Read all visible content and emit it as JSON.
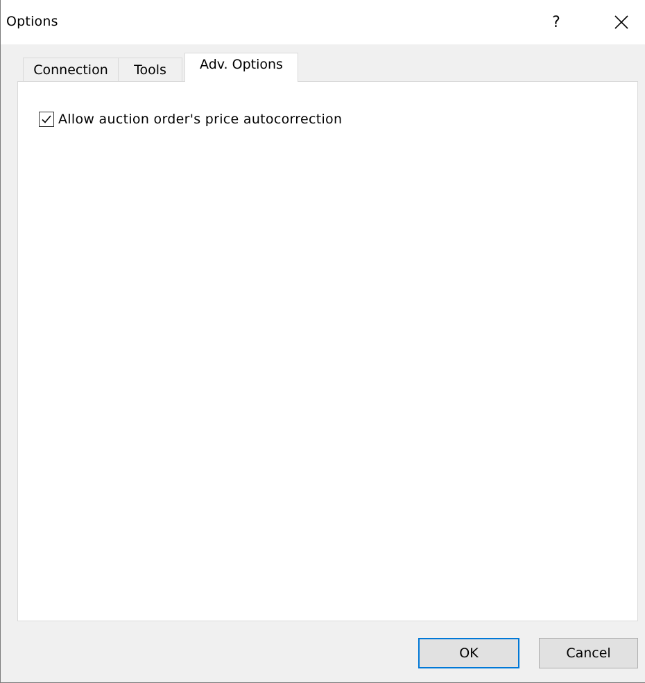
{
  "window": {
    "title": "Options",
    "help_label": "?",
    "close_icon": "close-icon"
  },
  "tabs": [
    {
      "label": "Connection",
      "active": false
    },
    {
      "label": "Tools",
      "active": false
    },
    {
      "label": "Adv. Options",
      "active": true
    }
  ],
  "adv_options": {
    "allow_autocorrection": {
      "label": "Allow auction order's price autocorrection",
      "checked": true
    }
  },
  "buttons": {
    "ok_label": "OK",
    "cancel_label": "Cancel"
  },
  "colors": {
    "default_button_border": "#0078d7",
    "panel_background": "#ffffff",
    "dialog_background": "#f0f0f0"
  }
}
